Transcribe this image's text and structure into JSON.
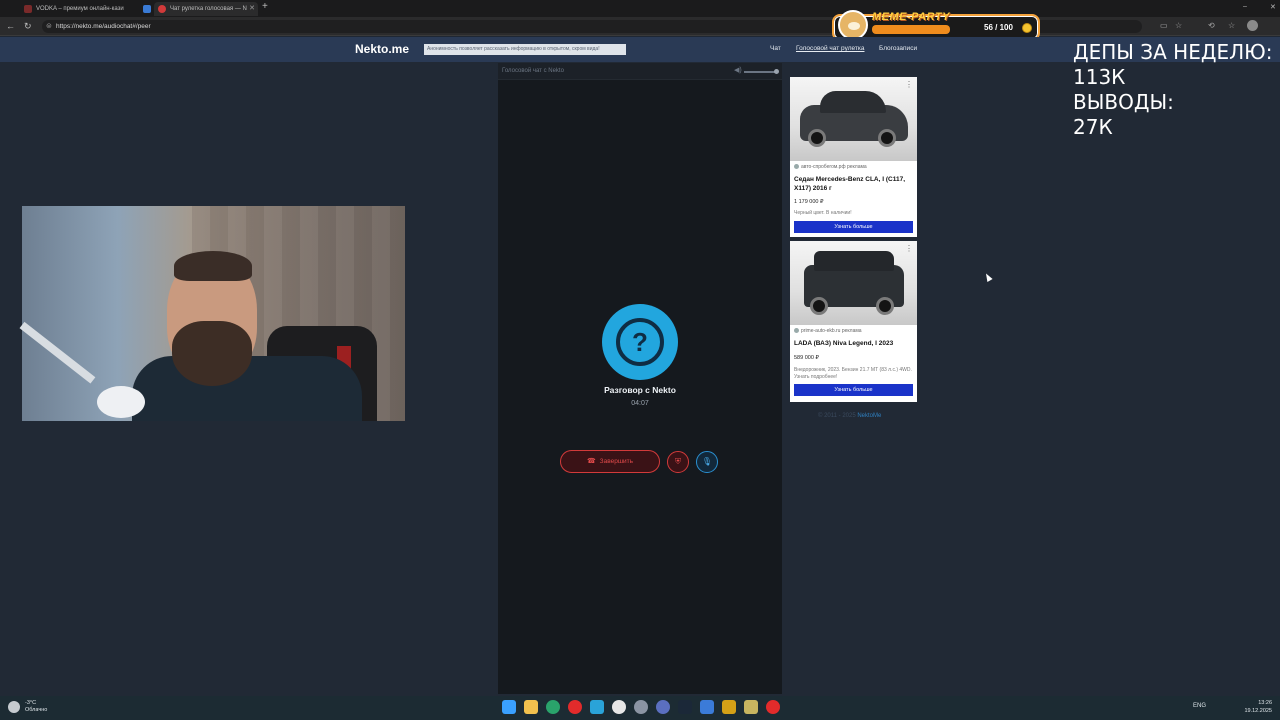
{
  "browser": {
    "tabs": [
      {
        "label": "VODKA – премиум онлайн-кази"
      },
      {
        "label": ""
      },
      {
        "label": "Чат рулетка голосовая — N"
      }
    ],
    "url": "https://nekto.me/audiochat#/peer"
  },
  "overlay_widget": {
    "title": "MEME-PARTY",
    "count": "56 / 100",
    "progress": 0.56
  },
  "site": {
    "logo": "Nekto.me",
    "slogan": "Анонимность позволяет рассказать информацию в открытом, скром вида!",
    "nav": [
      "Чат",
      "Голосовой чат рулетка",
      "Блогозаписи"
    ]
  },
  "chat": {
    "header": "Голосовой чат с Nekto",
    "title": "Разговор с Nekto",
    "timer": "04:07",
    "end_label": "Завершить"
  },
  "ads": [
    {
      "source": "авто-спробегом.рф",
      "tag": "реклама",
      "title": "Седан Mercedes-Benz CLA, I (C117, X117) 2016 г",
      "price": "1 179 000 ₽",
      "desc": "Черный цвет. В наличии!",
      "button": "Узнать больше"
    },
    {
      "source": "prime-auto-ekb.ru",
      "tag": "реклама",
      "title": "LADA (ВАЗ) Niva Legend, I 2023",
      "price": "589 000 ₽",
      "desc": "Внедорожник, 2023. Бензин 21.7 МТ (83 л.с.) 4WD. Узнать подробнее!",
      "button": "Узнать больше"
    }
  ],
  "footer": {
    "copyright": "© 2011 - 2025",
    "brand": "NektoMe"
  },
  "stream_overlay": {
    "line1": "ДЕПЫ ЗА НЕДЕЛЮ:",
    "line2": "113К",
    "line3": "ВЫВОДЫ:",
    "line4": "27К"
  },
  "taskbar": {
    "temp": "-3°C",
    "weather": "Облачно",
    "lang": "ENG",
    "time": "13:26",
    "date": "19.12.2025"
  }
}
